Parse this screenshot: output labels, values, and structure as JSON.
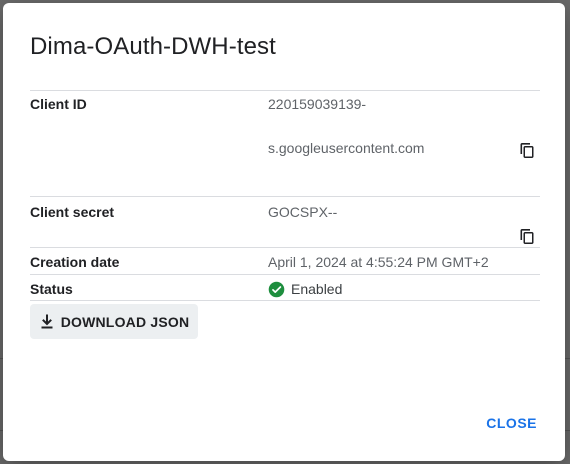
{
  "dialog": {
    "title": "Dima-OAuth-DWH-test",
    "fields": {
      "client_id": {
        "label": "Client ID",
        "value_line1": "220159039139-",
        "value_line2": "s.googleusercontent.com"
      },
      "client_secret": {
        "label": "Client secret",
        "value": "GOCSPX--"
      },
      "creation_date": {
        "label": "Creation date",
        "value": "April 1, 2024 at 4:55:24 PM GMT+2"
      },
      "status": {
        "label": "Status",
        "value": "Enabled"
      }
    },
    "download_label": "DOWNLOAD JSON",
    "close_label": "CLOSE"
  },
  "icons": {
    "copy": "copy-icon",
    "status_enabled": "check-circle-icon",
    "download": "download-icon"
  },
  "colors": {
    "accent": "#1a73e8",
    "enabled": "#1e8e3e",
    "button_bg": "#eceff1"
  }
}
